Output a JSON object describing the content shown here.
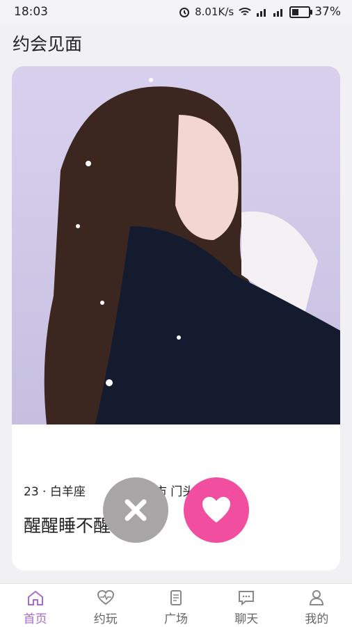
{
  "status_bar": {
    "time": "18:03",
    "net_speed": "8.01K/s",
    "battery": "37%"
  },
  "header": {
    "title": "约会见面"
  },
  "profile": {
    "name": "醒醒睡不醒",
    "age_sign": "23 · 白羊座",
    "location_partial": "市 门头"
  },
  "tabs": [
    {
      "label": "首页",
      "icon": "home-icon",
      "active": true
    },
    {
      "label": "约玩",
      "icon": "heart-pulse-icon",
      "active": false
    },
    {
      "label": "广场",
      "icon": "document-icon",
      "active": false
    },
    {
      "label": "聊天",
      "icon": "chat-icon",
      "active": false
    },
    {
      "label": "我的",
      "icon": "person-icon",
      "active": false
    }
  ],
  "colors": {
    "accent": "#a86bd3",
    "like": "#f24ea0",
    "dislike": "#a7a5a5"
  }
}
